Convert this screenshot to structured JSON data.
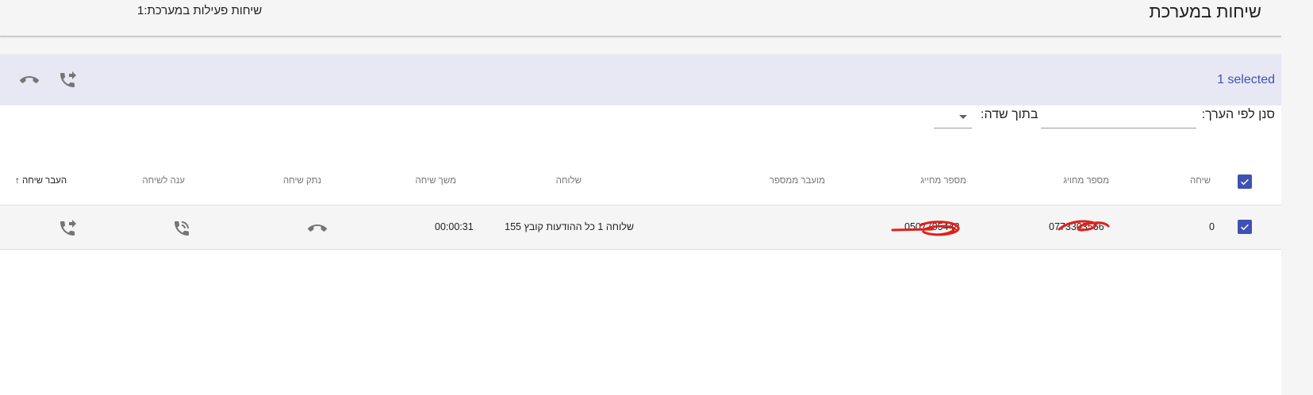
{
  "header": {
    "title": "שיחות במערכת",
    "active_calls": "שיחות פעילות במערכת:1"
  },
  "toolbar": {
    "selected_text": "1 selected",
    "hangup_icon": "call-end-icon",
    "transfer_icon": "phone-forwarded-icon"
  },
  "filter": {
    "value_label": "סנן לפי הערך:",
    "value_input": "",
    "field_label": "בתוך שדה:",
    "field_selected": ""
  },
  "table": {
    "columns": {
      "call": "שיחה",
      "dialed": "מספר מחויג",
      "caller": "מספר מחייג",
      "forwarded_from": "מועבר ממספר",
      "extension": "שלוחה",
      "duration": "משך שיחה",
      "hangup": "נתק שיחה",
      "answer": "ענה לשיחה",
      "transfer": "העבר שיחה"
    },
    "sort_indicator": "↑",
    "rows": [
      {
        "call": "0",
        "dialed": "0773303566",
        "caller": "0507705448",
        "forwarded_from": "",
        "extension": "שלוחה 1 כל ההודעות קובץ 155",
        "duration": "00:00:31"
      }
    ]
  },
  "colors": {
    "accent": "#3f51b5",
    "toolbar_bg": "#e8e8f4",
    "redaction": "#e0201b",
    "icon": "#757575"
  }
}
